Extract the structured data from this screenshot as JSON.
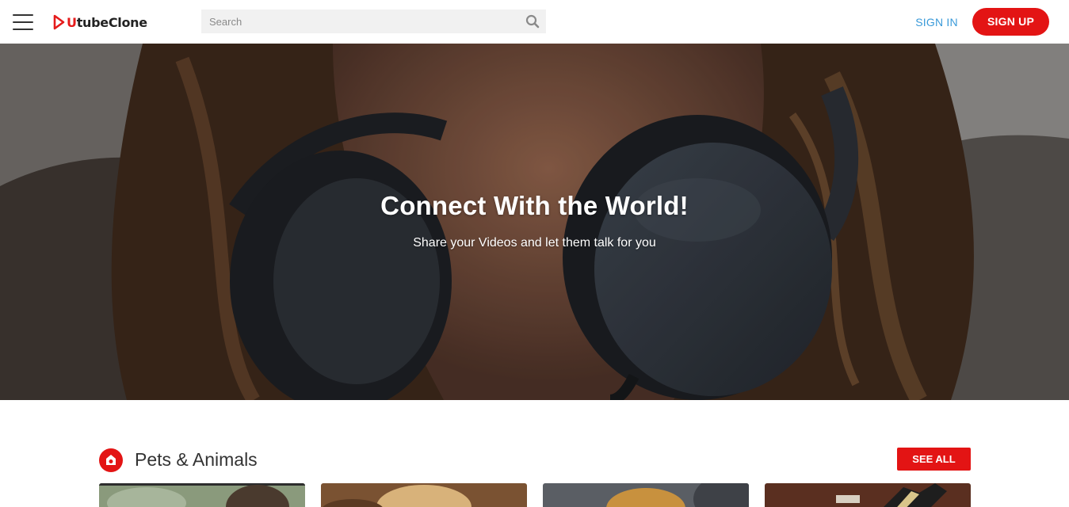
{
  "app": {
    "logo_u": "U",
    "logo_rest": "tubeClone"
  },
  "header": {
    "search_placeholder": "Search",
    "signin_label": "SIGN IN",
    "signup_label": "SIGN UP"
  },
  "hero": {
    "title": "Connect With the World!",
    "subtitle": "Share your Videos and let them talk for you"
  },
  "category": {
    "title": "Pets & Animals",
    "icon": "pets-icon",
    "see_all_label": "SEE ALL",
    "videos": [
      {
        "thumbnail": "video-thumbnail-1"
      },
      {
        "thumbnail": "video-thumbnail-2"
      },
      {
        "thumbnail": "video-thumbnail-3"
      },
      {
        "thumbnail": "video-thumbnail-4"
      }
    ]
  },
  "colors": {
    "brand": "#e31414",
    "link": "#3a9ad9",
    "search_bg": "#f1f1f1"
  }
}
